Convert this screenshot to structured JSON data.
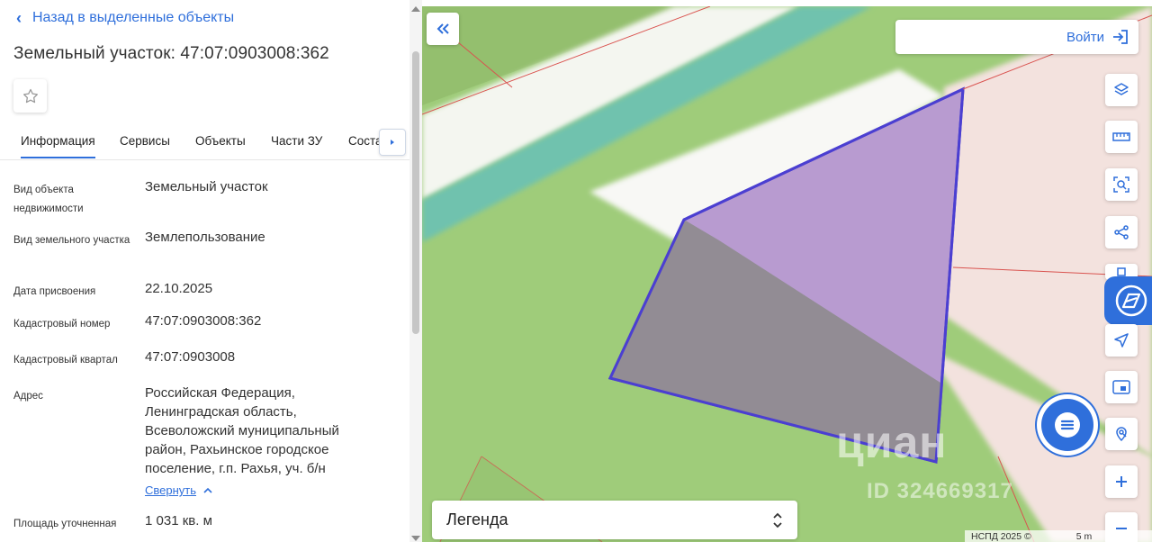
{
  "panel": {
    "back_label": "Назад в выделенные объекты",
    "title": "Земельный участок: 47:07:0903008:362",
    "tabs": [
      {
        "label": "Информация",
        "active": true
      },
      {
        "label": "Сервисы"
      },
      {
        "label": "Объекты"
      },
      {
        "label": "Части ЗУ"
      },
      {
        "label": "Соста"
      }
    ],
    "fields": [
      {
        "label": "Вид объекта недвижимости",
        "value": "Земельный участок"
      },
      {
        "label": "Вид земельного участка",
        "value": "Землепользование"
      },
      {
        "label": "Дата присвоения",
        "value": "22.10.2025"
      },
      {
        "label": "Кадастровый номер",
        "value": "47:07:0903008:362"
      },
      {
        "label": "Кадастровый квартал",
        "value": "47:07:0903008"
      },
      {
        "label": "Адрес",
        "value": "Российская Федерация, Ленинградская область, Всеволожский муниципальный район, Рахьинское городское поселение, г.п. Рахья, уч. б/н"
      },
      {
        "label": "Площадь уточненная",
        "value": "1 031 кв. м"
      }
    ],
    "collapse_label": "Свернуть"
  },
  "map": {
    "login_label": "Войти",
    "legend_label": "Легенда",
    "watermark": "циан",
    "watermark_id": "ID 324669317",
    "attribution": "НСПД 2025 ©",
    "scale": "5 m",
    "tools": [
      "layers-icon",
      "ruler-icon",
      "area-search-icon",
      "share-icon",
      "print-icon",
      "locate-icon",
      "minimap-icon",
      "geo-search-icon",
      "zoom-in-icon",
      "zoom-out-icon"
    ]
  },
  "colors": {
    "accent": "#2f6fdb",
    "parcel_fill": "#b89bd0",
    "parcel_stroke": "#4b3fd1",
    "map_green": "#9fcc7a",
    "map_teal": "#6fc2ae"
  }
}
